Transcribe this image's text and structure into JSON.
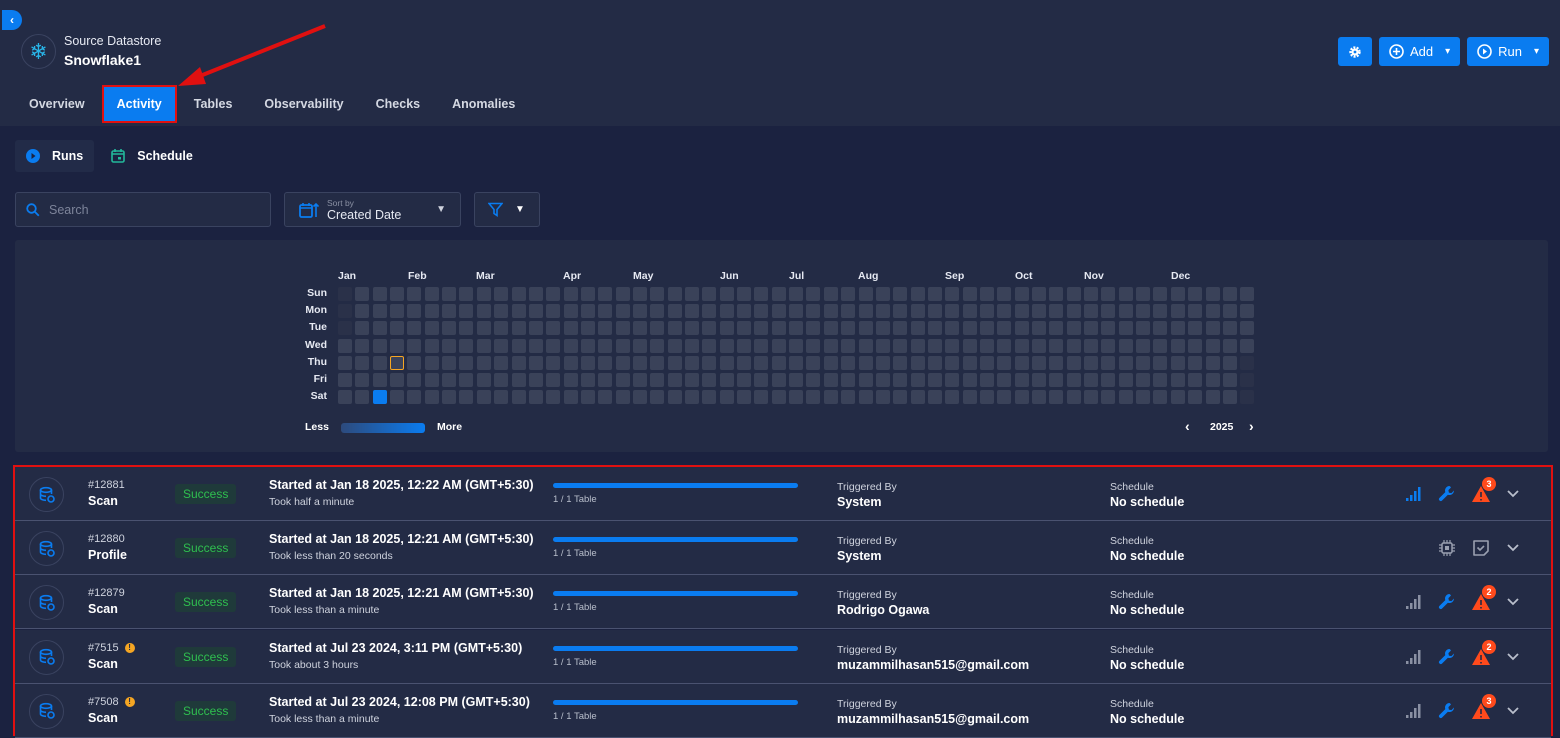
{
  "header": {
    "datastore_type": "Source Datastore",
    "datastore_name": "Snowflake1",
    "tabs": [
      {
        "label": "Overview"
      },
      {
        "label": "Activity",
        "active": true
      },
      {
        "label": "Tables"
      },
      {
        "label": "Observability"
      },
      {
        "label": "Checks"
      },
      {
        "label": "Anomalies"
      }
    ],
    "buttons": {
      "settings": "gear-icon",
      "add": "Add",
      "run": "Run"
    }
  },
  "subnav": {
    "runs": "Runs",
    "schedule": "Schedule"
  },
  "toolbar": {
    "search_placeholder": "Search",
    "sort_label": "Sort by",
    "sort_value": "Created Date"
  },
  "heatmap": {
    "year": "2025",
    "months": [
      "Jan",
      "Feb",
      "Mar",
      "Apr",
      "May",
      "Jun",
      "Jul",
      "Aug",
      "Sep",
      "Oct",
      "Nov",
      "Dec"
    ],
    "days": [
      "Sun",
      "Mon",
      "Tue",
      "Wed",
      "Thu",
      "Fri",
      "Sat"
    ],
    "legend_less": "Less",
    "legend_more": "More",
    "active_days": [
      "2025-01-18"
    ],
    "outlined_day": "2025-01-23",
    "accent": "#0a7cf0"
  },
  "runs": [
    {
      "id": "#12881",
      "type": "Scan",
      "warn": false,
      "status": "Success",
      "started": "Started at Jan 18 2025, 12:22 AM (GMT+5:30)",
      "took": "Took half a minute",
      "progress": 1,
      "tables": "1 / 1 Table",
      "triggered_label": "Triggered By",
      "triggered_by": "System",
      "schedule_label": "Schedule",
      "schedule": "No schedule",
      "anomalies": "3",
      "signal_active": true
    },
    {
      "id": "#12880",
      "type": "Profile",
      "warn": false,
      "status": "Success",
      "started": "Started at Jan 18 2025, 12:21 AM (GMT+5:30)",
      "took": "Took less than 20 seconds",
      "progress": 1,
      "tables": "1 / 1 Table",
      "triggered_label": "Triggered By",
      "triggered_by": "System",
      "schedule_label": "Schedule",
      "schedule": "No schedule",
      "anomalies": null
    },
    {
      "id": "#12879",
      "type": "Scan",
      "warn": false,
      "status": "Success",
      "started": "Started at Jan 18 2025, 12:21 AM (GMT+5:30)",
      "took": "Took less than a minute",
      "progress": 1,
      "tables": "1 / 1 Table",
      "triggered_label": "Triggered By",
      "triggered_by": "Rodrigo Ogawa",
      "schedule_label": "Schedule",
      "schedule": "No schedule",
      "anomalies": "2",
      "signal_active": false
    },
    {
      "id": "#7515",
      "type": "Scan",
      "warn": true,
      "status": "Success",
      "started": "Started at Jul 23 2024, 3:11 PM (GMT+5:30)",
      "took": "Took about 3 hours",
      "progress": 1,
      "tables": "1 / 1 Table",
      "triggered_label": "Triggered By",
      "triggered_by": "muzammilhasan515@gmail.com",
      "schedule_label": "Schedule",
      "schedule": "No schedule",
      "anomalies": "2",
      "signal_active": false
    },
    {
      "id": "#7508",
      "type": "Scan",
      "warn": true,
      "status": "Success",
      "started": "Started at Jul 23 2024, 12:08 PM (GMT+5:30)",
      "took": "Took less than a minute",
      "progress": 1,
      "tables": "1 / 1 Table",
      "triggered_label": "Triggered By",
      "triggered_by": "muzammilhasan515@gmail.com",
      "schedule_label": "Schedule",
      "schedule": "No schedule",
      "anomalies": "3",
      "signal_active": false
    }
  ]
}
